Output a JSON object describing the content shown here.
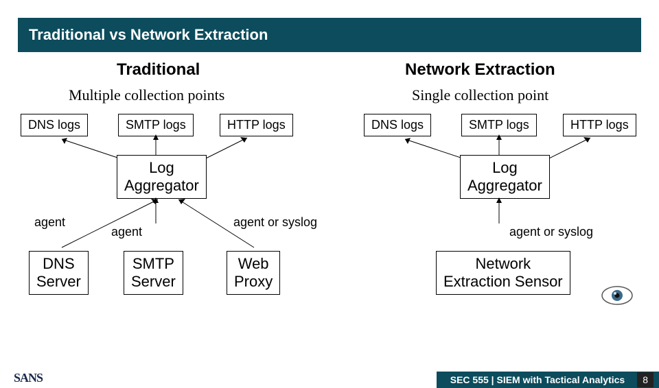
{
  "title": "Traditional vs Network Extraction",
  "left": {
    "header": "Traditional",
    "sub": "Multiple collection points",
    "logs": {
      "dns": "DNS logs",
      "smtp": "SMTP logs",
      "http": "HTTP logs"
    },
    "aggregator": "Log\nAggregator",
    "agents": {
      "left": "agent",
      "mid": "agent",
      "right": "agent or syslog"
    },
    "servers": {
      "dns": "DNS\nServer",
      "smtp": "SMTP\nServer",
      "web": "Web\nProxy"
    }
  },
  "right": {
    "header": "Network Extraction",
    "sub": "Single collection point",
    "logs": {
      "dns": "DNS logs",
      "smtp": "SMTP logs",
      "http": "HTTP logs"
    },
    "aggregator": "Log\nAggregator",
    "agent": "agent or syslog",
    "sensor": "Network\nExtraction Sensor"
  },
  "footer": {
    "course": "SEC 555 | SIEM with Tactical Analytics",
    "page": "8"
  },
  "logo": "SANS"
}
